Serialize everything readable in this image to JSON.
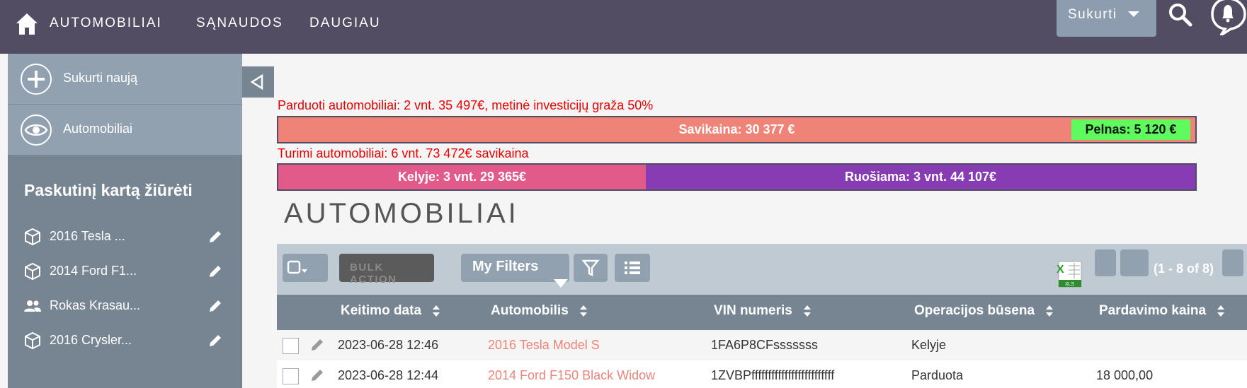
{
  "nav": {
    "links": [
      "AUTOMOBILIAI",
      "SĄNAUDOS",
      "DAUGIAU"
    ],
    "create_label": "Sukurti"
  },
  "sidebar": {
    "actions": [
      {
        "label": "Sukurti naują",
        "icon": "plus-circle-icon"
      },
      {
        "label": "Automobiliai",
        "icon": "eye-icon"
      }
    ],
    "recent_title": "Paskutinį kartą žiūrėti",
    "recent": [
      {
        "label": "2016 Tesla ...",
        "icon": "cube-icon"
      },
      {
        "label": "2014 Ford F1...",
        "icon": "cube-icon"
      },
      {
        "label": "Rokas Krasau...",
        "icon": "users-icon"
      },
      {
        "label": "2016 Crysler...",
        "icon": "cube-icon"
      }
    ]
  },
  "summary": {
    "sold_text": "Parduoti automobiliai: 2 vnt. 35 497€, metinė investicijų graža 50%",
    "cost_label": "Savikaina: 30 377 €",
    "profit_label": "Pelnas: 5 120 €",
    "owned_text": "Turimi automobiliai: 6 vnt. 73 472€ savikaina",
    "in_transit_label": "Kelyje: 3 vnt. 29 365€",
    "preparing_label": "Ruošiama: 3 vnt. 44 107€",
    "colors": {
      "cost": "#f08377",
      "profit": "#5efa5e",
      "transit": "#e25a8a",
      "preparing": "#873cb3",
      "alert_text": "#ec0000"
    }
  },
  "page_title": "AUTOMOBILIAI",
  "toolbar": {
    "bulk_action": "BULK ACTION",
    "my_filters": "My Filters",
    "pagination": "(1 - 8 of 8)"
  },
  "table": {
    "columns": [
      "Keitimo data",
      "Automobilis",
      "VIN numeris",
      "Operacijos būsena",
      "Pardavimo kaina"
    ],
    "rows": [
      {
        "date": "2023-06-28 12:46",
        "car": "2016 Tesla Model S",
        "vin": "1FA6P8CFsssssss",
        "status": "Kelyje",
        "price": ""
      },
      {
        "date": "2023-06-28 12:44",
        "car": "2014 Ford F150 Black Widow",
        "vin": "1ZVBPfffffffffffffffffffffffff",
        "status": "Parduota",
        "price": "18 000,00"
      }
    ]
  }
}
